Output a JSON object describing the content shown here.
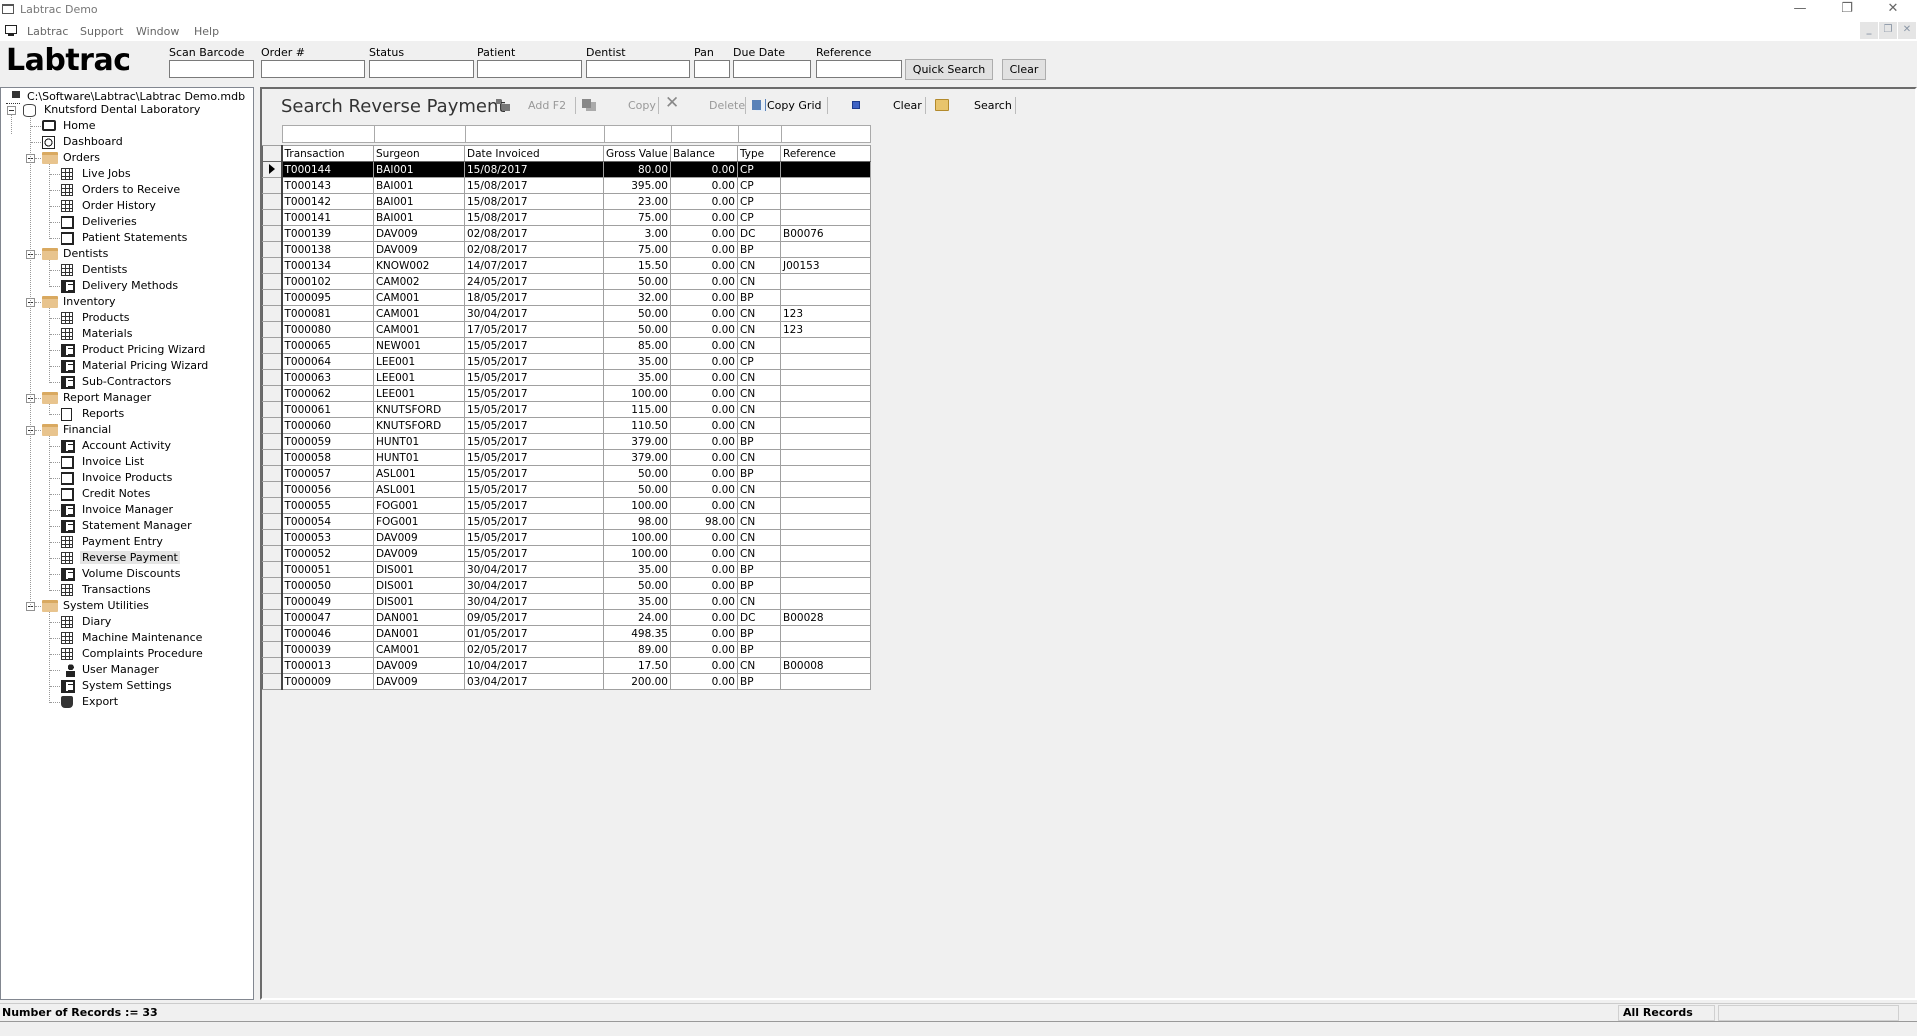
{
  "window": {
    "title": "Labtrac Demo",
    "controls": {
      "minimize": "—",
      "restore": "❐",
      "close": "✕"
    }
  },
  "menubar": {
    "items": [
      "Labtrac",
      "Support",
      "Window",
      "Help"
    ],
    "mdi_controls": {
      "minimize": "_",
      "restore": "❐",
      "close": "✕"
    }
  },
  "topbar": {
    "logo": "Labtrac",
    "fields": [
      {
        "label": "Scan Barcode",
        "value": ""
      },
      {
        "label": "Order #",
        "value": ""
      },
      {
        "label": "Status",
        "value": ""
      },
      {
        "label": "Patient",
        "value": ""
      },
      {
        "label": "Dentist",
        "value": ""
      },
      {
        "label": "Pan",
        "value": ""
      },
      {
        "label": "Due Date",
        "value": ""
      },
      {
        "label": "Reference",
        "value": ""
      }
    ],
    "quick_search_label": "Quick Search",
    "clear_label": "Clear"
  },
  "tree": {
    "root": "C:\\Software\\Labtrac\\Labtrac Demo.mdb",
    "lab": "Knutsford Dental Laboratory",
    "home": "Home",
    "dashboard": "Dashboard",
    "groups": [
      {
        "label": "Orders",
        "items": [
          {
            "label": "Live Jobs",
            "icon": "grid-icon"
          },
          {
            "label": "Orders to Receive",
            "icon": "grid-icon"
          },
          {
            "label": "Order History",
            "icon": "grid-icon"
          },
          {
            "label": "Deliveries",
            "icon": "search-document-icon"
          },
          {
            "label": "Patient Statements",
            "icon": "search-document-icon"
          }
        ]
      },
      {
        "label": "Dentists",
        "items": [
          {
            "label": "Dentists",
            "icon": "grid-icon"
          },
          {
            "label": "Delivery Methods",
            "icon": "form-icon"
          }
        ]
      },
      {
        "label": "Inventory",
        "items": [
          {
            "label": "Products",
            "icon": "grid-icon"
          },
          {
            "label": "Materials",
            "icon": "grid-icon"
          },
          {
            "label": "Product Pricing Wizard",
            "icon": "form-icon"
          },
          {
            "label": "Material Pricing Wizard",
            "icon": "form-icon"
          },
          {
            "label": "Sub-Contractors",
            "icon": "form-icon"
          }
        ]
      },
      {
        "label": "Report Manager",
        "items": [
          {
            "label": "Reports",
            "icon": "report-icon"
          }
        ]
      },
      {
        "label": "Financial",
        "items": [
          {
            "label": "Account Activity",
            "icon": "form-icon"
          },
          {
            "label": "Invoice List",
            "icon": "search-document-icon"
          },
          {
            "label": "Invoice Products",
            "icon": "search-document-icon"
          },
          {
            "label": "Credit Notes",
            "icon": "search-document-icon"
          },
          {
            "label": "Invoice Manager",
            "icon": "form-icon"
          },
          {
            "label": "Statement Manager",
            "icon": "form-icon"
          },
          {
            "label": "Payment Entry",
            "icon": "grid-icon"
          },
          {
            "label": "Reverse Payment",
            "icon": "grid-icon",
            "selected": true
          },
          {
            "label": "Volume Discounts",
            "icon": "form-icon"
          },
          {
            "label": "Transactions",
            "icon": "grid-icon"
          }
        ]
      },
      {
        "label": "System Utilities",
        "items": [
          {
            "label": "Diary",
            "icon": "calendar-icon"
          },
          {
            "label": "Machine Maintenance",
            "icon": "grid-icon"
          },
          {
            "label": "Complaints Procedure",
            "icon": "grid-icon"
          },
          {
            "label": "User Manager",
            "icon": "user-icon"
          },
          {
            "label": "System Settings",
            "icon": "form-icon"
          },
          {
            "label": "Export",
            "icon": "export-icon"
          }
        ]
      }
    ]
  },
  "panel": {
    "title": "Search Reverse Payment",
    "toolbar": {
      "add": "Add  F2",
      "copy": "Copy",
      "delete": "Delete",
      "copy_grid": "Copy Grid",
      "clear": "Clear",
      "search": "Search"
    },
    "columns": [
      "Transaction",
      "Surgeon",
      "Date Invoiced",
      "Gross Value",
      "Balance",
      "Type",
      "Reference"
    ],
    "rows": [
      [
        "T000144",
        "BAI001",
        "15/08/2017",
        "80.00",
        "0.00",
        "CP",
        ""
      ],
      [
        "T000143",
        "BAI001",
        "15/08/2017",
        "395.00",
        "0.00",
        "CP",
        ""
      ],
      [
        "T000142",
        "BAI001",
        "15/08/2017",
        "23.00",
        "0.00",
        "CP",
        ""
      ],
      [
        "T000141",
        "BAI001",
        "15/08/2017",
        "75.00",
        "0.00",
        "CP",
        ""
      ],
      [
        "T000139",
        "DAV009",
        "02/08/2017",
        "3.00",
        "0.00",
        "DC",
        "B00076"
      ],
      [
        "T000138",
        "DAV009",
        "02/08/2017",
        "75.00",
        "0.00",
        "BP",
        ""
      ],
      [
        "T000134",
        "KNOW002",
        "14/07/2017",
        "15.50",
        "0.00",
        "CN",
        "J00153"
      ],
      [
        "T000102",
        "CAM002",
        "24/05/2017",
        "50.00",
        "0.00",
        "CN",
        ""
      ],
      [
        "T000095",
        "CAM001",
        "18/05/2017",
        "32.00",
        "0.00",
        "BP",
        ""
      ],
      [
        "T000081",
        "CAM001",
        "30/04/2017",
        "50.00",
        "0.00",
        "CN",
        "123"
      ],
      [
        "T000080",
        "CAM001",
        "17/05/2017",
        "50.00",
        "0.00",
        "CN",
        "123"
      ],
      [
        "T000065",
        "NEW001",
        "15/05/2017",
        "85.00",
        "0.00",
        "CN",
        ""
      ],
      [
        "T000064",
        "LEE001",
        "15/05/2017",
        "35.00",
        "0.00",
        "CP",
        ""
      ],
      [
        "T000063",
        "LEE001",
        "15/05/2017",
        "35.00",
        "0.00",
        "CN",
        ""
      ],
      [
        "T000062",
        "LEE001",
        "15/05/2017",
        "100.00",
        "0.00",
        "CN",
        ""
      ],
      [
        "T000061",
        "KNUTSFORD",
        "15/05/2017",
        "115.00",
        "0.00",
        "CN",
        ""
      ],
      [
        "T000060",
        "KNUTSFORD",
        "15/05/2017",
        "110.50",
        "0.00",
        "CN",
        ""
      ],
      [
        "T000059",
        "HUNT01",
        "15/05/2017",
        "379.00",
        "0.00",
        "BP",
        ""
      ],
      [
        "T000058",
        "HUNT01",
        "15/05/2017",
        "379.00",
        "0.00",
        "CN",
        ""
      ],
      [
        "T000057",
        "ASL001",
        "15/05/2017",
        "50.00",
        "0.00",
        "BP",
        ""
      ],
      [
        "T000056",
        "ASL001",
        "15/05/2017",
        "50.00",
        "0.00",
        "CN",
        ""
      ],
      [
        "T000055",
        "FOG001",
        "15/05/2017",
        "100.00",
        "0.00",
        "CN",
        ""
      ],
      [
        "T000054",
        "FOG001",
        "15/05/2017",
        "98.00",
        "98.00",
        "CN",
        ""
      ],
      [
        "T000053",
        "DAV009",
        "15/05/2017",
        "100.00",
        "0.00",
        "CN",
        ""
      ],
      [
        "T000052",
        "DAV009",
        "15/05/2017",
        "100.00",
        "0.00",
        "CN",
        ""
      ],
      [
        "T000051",
        "DIS001",
        "30/04/2017",
        "35.00",
        "0.00",
        "BP",
        ""
      ],
      [
        "T000050",
        "DIS001",
        "30/04/2017",
        "50.00",
        "0.00",
        "BP",
        ""
      ],
      [
        "T000049",
        "DIS001",
        "30/04/2017",
        "35.00",
        "0.00",
        "CN",
        ""
      ],
      [
        "T000047",
        "DAN001",
        "09/05/2017",
        "24.00",
        "0.00",
        "DC",
        "B00028"
      ],
      [
        "T000046",
        "DAN001",
        "01/05/2017",
        "498.35",
        "0.00",
        "BP",
        ""
      ],
      [
        "T000039",
        "CAM001",
        "02/05/2017",
        "89.00",
        "0.00",
        "BP",
        ""
      ],
      [
        "T000013",
        "DAV009",
        "10/04/2017",
        "17.50",
        "0.00",
        "CN",
        "B00008"
      ],
      [
        "T000009",
        "DAV009",
        "03/04/2017",
        "200.00",
        "0.00",
        "BP",
        ""
      ]
    ],
    "selected_row": 0
  },
  "statusbar": {
    "records": "Number of Records := 33",
    "filter": "All Records",
    "extra": ""
  }
}
